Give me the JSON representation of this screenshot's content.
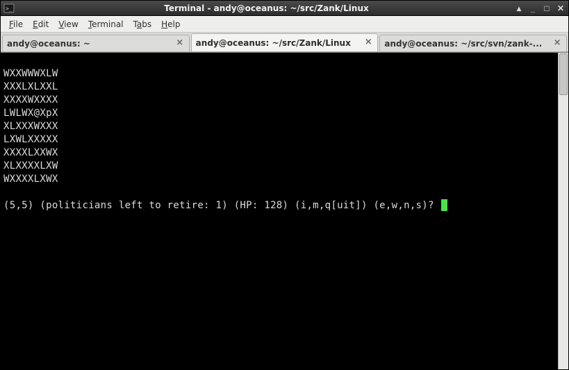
{
  "window": {
    "title": "Terminal - andy@oceanus: ~/src/Zank/Linux"
  },
  "menu": {
    "file": "File",
    "edit": "Edit",
    "view": "View",
    "terminal": "Terminal",
    "tabs": "Tabs",
    "help": "Help"
  },
  "tabs": [
    {
      "label": "andy@oceanus: ~",
      "active": false
    },
    {
      "label": "andy@oceanus: ~/src/Zank/Linux",
      "active": true
    },
    {
      "label": "andy@oceanus: ~/src/svn/zank-...",
      "active": false
    }
  ],
  "terminal": {
    "map": [
      "WXXWWWXLW",
      "XXXLXLXXL",
      "XXXXWXXXX",
      "LWLWX@XpX",
      "XLXXXWXXX",
      "LXWLXXXXX",
      "XXXXLXXWX",
      "XLXXXXLXW",
      "WXXXXLXWX"
    ],
    "status": "(5,5) (politicians left to retire: 1) (HP: 128) (i,m,q[uit]) (e,w,n,s)? "
  }
}
